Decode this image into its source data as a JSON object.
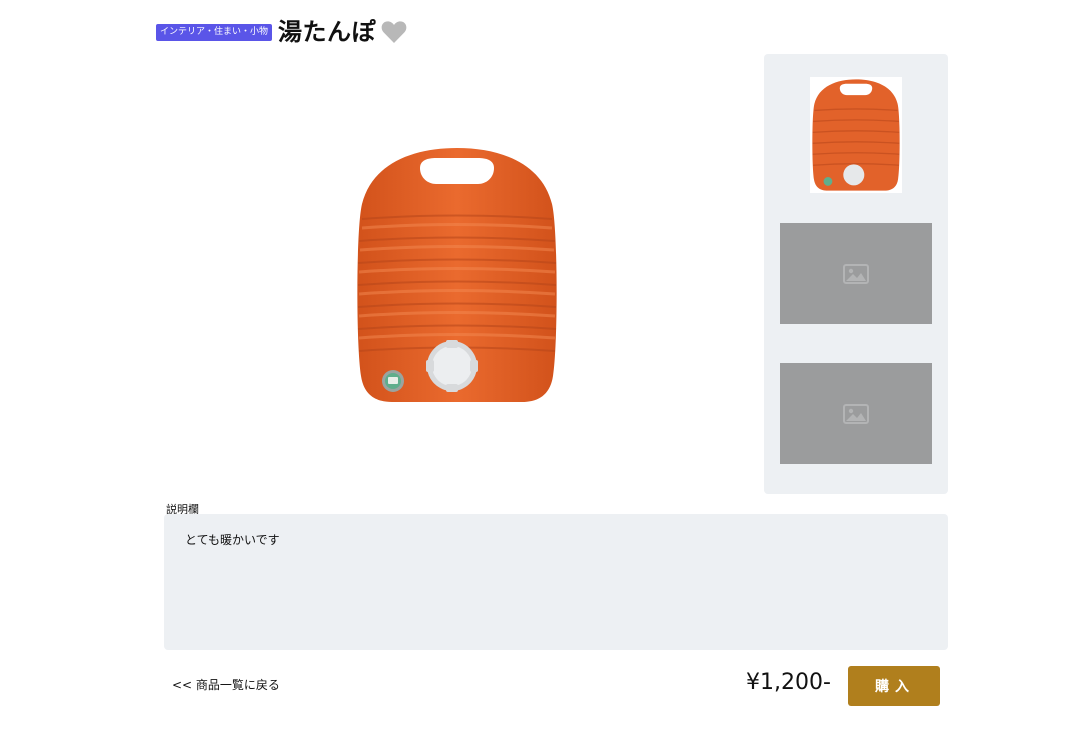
{
  "product": {
    "category": "インテリア・住まい・小物",
    "title": "湯たんぽ",
    "favorite_icon": "heart-icon",
    "main_image_icon": "hot-water-bottle-image",
    "thumbnails": [
      {
        "icon": "hot-water-bottle-image"
      },
      {
        "icon": "image-placeholder-icon"
      },
      {
        "icon": "image-placeholder-icon"
      }
    ]
  },
  "description": {
    "label": "説明欄",
    "text": "とても暖かいです"
  },
  "footer": {
    "back_label": "<< 商品一覧に戻る",
    "price": "¥1,200-",
    "buy_label": "購入"
  },
  "colors": {
    "badge": "#5a55e8",
    "buy_button": "#b07f1d",
    "product_orange": "#e2622a",
    "panel_bg": "#edf0f3",
    "placeholder_bg": "#9b9c9d"
  }
}
